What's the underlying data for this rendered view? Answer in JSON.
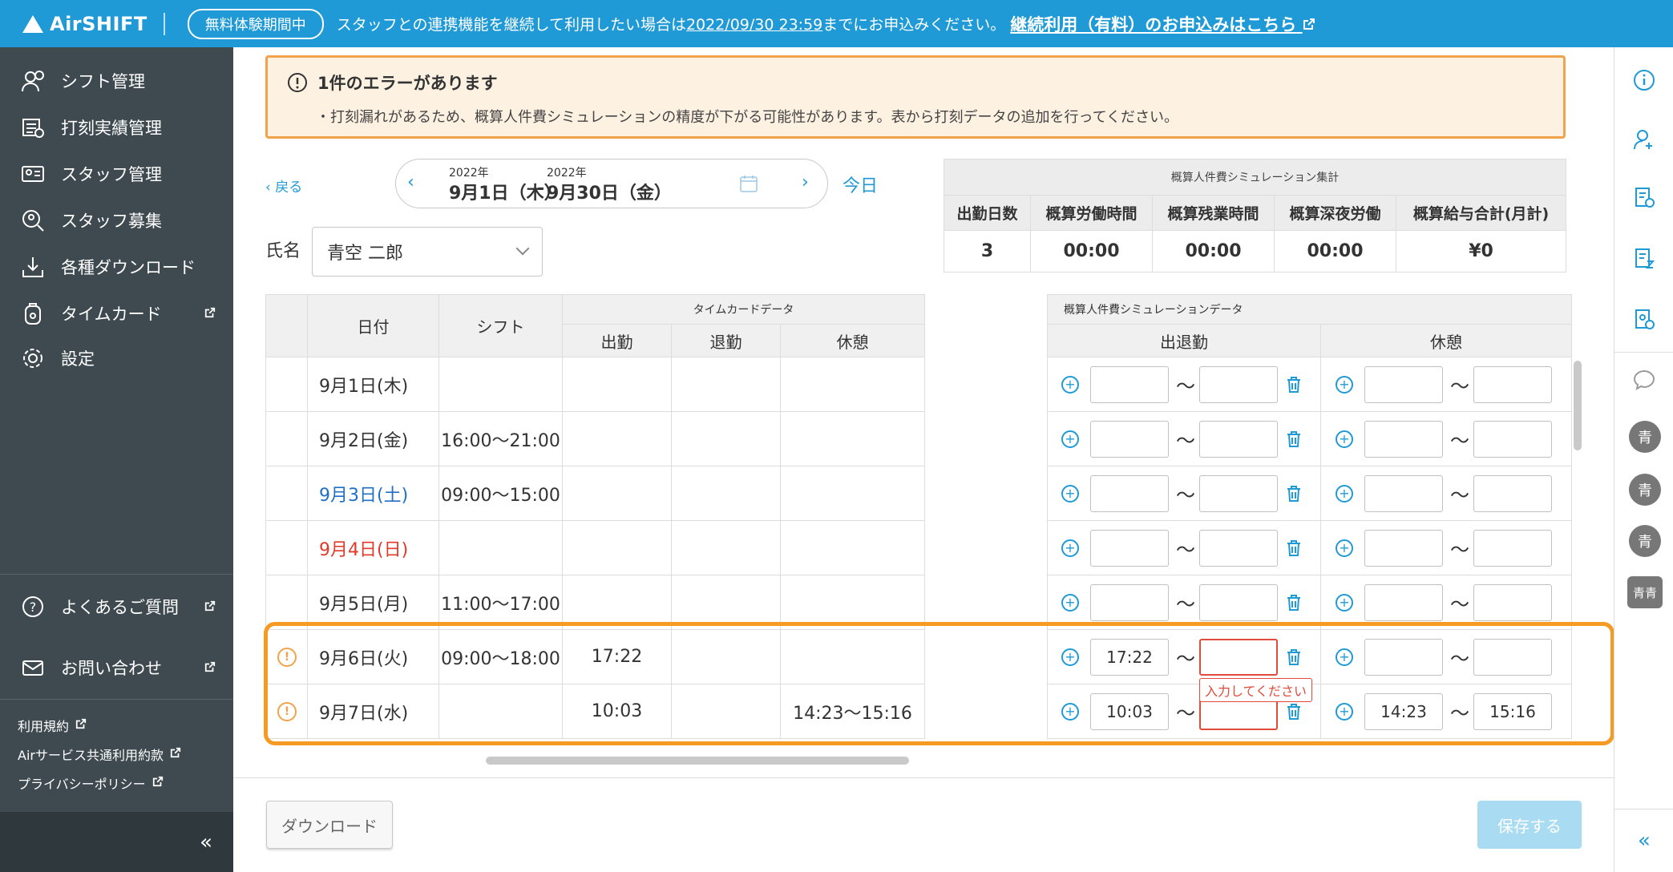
{
  "banner": {
    "logo": "AirSHIFT",
    "trial_badge": "無料体験期間中",
    "msg_before": "スタッフとの連携機能を継続して利用したい場合は",
    "deadline": "2022/09/30 23:59",
    "msg_after": "までにお申込みください。",
    "link": "継続利用（有料）のお申込みはこちら"
  },
  "sidebar": {
    "items": [
      {
        "label": "シフト管理",
        "icon": "shift-icon"
      },
      {
        "label": "打刻実績管理",
        "icon": "timecard-record-icon"
      },
      {
        "label": "スタッフ管理",
        "icon": "staff-icon"
      },
      {
        "label": "スタッフ募集",
        "icon": "recruit-icon"
      },
      {
        "label": "各種ダウンロード",
        "icon": "download-icon"
      },
      {
        "label": "タイムカード",
        "icon": "timecard-icon"
      },
      {
        "label": "設定",
        "icon": "gear-icon"
      }
    ],
    "faq": "よくあるご質問",
    "contact": "お問い合わせ",
    "terms": "利用規約",
    "air_terms": "Airサービス共通利用約款",
    "privacy": "プライバシーポリシー",
    "collapse": "«"
  },
  "error": {
    "title": "1件のエラーがあります",
    "message": "・打刻漏れがあるため、概算人件費シミュレーションの精度が下がる可能性があります。表から打刻データの追加を行ってください。"
  },
  "nav": {
    "back": "戻る",
    "start_year": "2022年",
    "start_date": "9月1日（木）",
    "sep": "-",
    "end_year": "2022年",
    "end_date": "9月30日（金）",
    "today": "今日"
  },
  "name": {
    "label": "氏名",
    "value": "青空 二郎"
  },
  "summary": {
    "caption": "概算人件費シミュレーション集計",
    "headers": [
      "出勤日数",
      "概算労働時間",
      "概算残業時間",
      "概算深夜労働",
      "概算給与合計(月計)"
    ],
    "values": [
      "3",
      "00:00",
      "00:00",
      "00:00",
      "¥0"
    ]
  },
  "table": {
    "h_date": "日付",
    "h_shift": "シフト",
    "h_timecard": "タイムカードデータ",
    "h_in": "出勤",
    "h_out": "退勤",
    "h_break": "休憩",
    "h_sim": "概算人件費シミュレーションデータ",
    "h_inout": "出退勤",
    "h_sim_break": "休憩",
    "tilde": "〜",
    "tooltip": "入力してください",
    "rows": [
      {
        "date": "9月1日(木)",
        "shift": "",
        "in": "",
        "out": "",
        "brk": "",
        "s_in": "",
        "s_out": "",
        "b_in": "",
        "b_out": ""
      },
      {
        "date": "9月2日(金)",
        "shift": "16:00〜21:00",
        "in": "",
        "out": "",
        "brk": "",
        "s_in": "",
        "s_out": "",
        "b_in": "",
        "b_out": ""
      },
      {
        "date": "9月3日(土)",
        "shift": "09:00〜15:00",
        "in": "",
        "out": "",
        "brk": "",
        "s_in": "",
        "s_out": "",
        "b_in": "",
        "b_out": ""
      },
      {
        "date": "9月4日(日)",
        "shift": "",
        "in": "",
        "out": "",
        "brk": "",
        "s_in": "",
        "s_out": "",
        "b_in": "",
        "b_out": ""
      },
      {
        "date": "9月5日(月)",
        "shift": "11:00〜17:00",
        "in": "",
        "out": "",
        "brk": "",
        "s_in": "",
        "s_out": "",
        "b_in": "",
        "b_out": ""
      },
      {
        "date": "9月6日(火)",
        "shift": "09:00〜18:00",
        "in": "17:22",
        "out": "",
        "brk": "",
        "s_in": "17:22",
        "s_out": "",
        "b_in": "",
        "b_out": ""
      },
      {
        "date": "9月7日(水)",
        "shift": "",
        "in": "10:03",
        "out": "",
        "brk": "14:23〜15:16",
        "s_in": "10:03",
        "s_out": "",
        "b_in": "14:23",
        "b_out": "15:16"
      }
    ]
  },
  "rail": {
    "avatar": "青",
    "avatar_group": "青青"
  },
  "footer": {
    "download": "ダウンロード",
    "save": "保存する"
  },
  "colors": {
    "accent": "#1f9ad6",
    "sidebar": "#3f4a50",
    "warning": "#f59a23",
    "error": "#e04b3c"
  }
}
